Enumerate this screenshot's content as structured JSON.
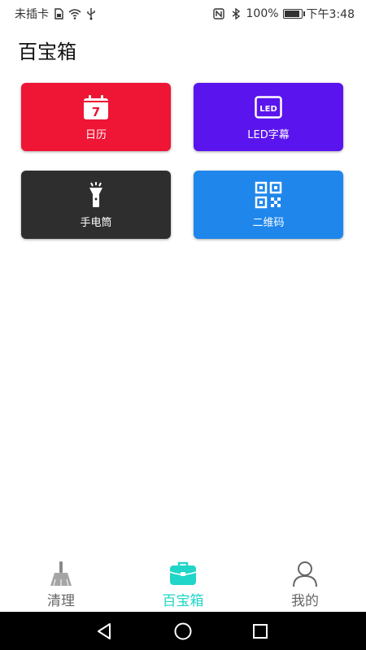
{
  "status_bar": {
    "carrier": "未插卡",
    "battery_percent": "100%",
    "battery_level": 1.0,
    "time": "下午3:48",
    "icons": [
      "sim-card-icon",
      "wifi-icon",
      "usb-icon",
      "nfc-icon",
      "bluetooth-icon",
      "battery-icon"
    ]
  },
  "page": {
    "title": "百宝箱"
  },
  "tools": [
    {
      "label": "日历",
      "icon": "calendar-icon",
      "icon_text": "7",
      "color": "#ee1535"
    },
    {
      "label": "LED字幕",
      "icon": "led-icon",
      "icon_text": "LED",
      "color": "#5a14ee"
    },
    {
      "label": "手电筒",
      "icon": "flashlight-icon",
      "color": "#2e2e2e"
    },
    {
      "label": "二维码",
      "icon": "qrcode-icon",
      "color": "#1f86eb"
    }
  ],
  "bottom_nav": {
    "items": [
      {
        "label": "清理",
        "icon": "broom-icon",
        "active": false
      },
      {
        "label": "百宝箱",
        "icon": "briefcase-icon",
        "active": true
      },
      {
        "label": "我的",
        "icon": "user-icon",
        "active": false
      }
    ],
    "active_color": "#1fd6c8",
    "inactive_color": "#666666"
  },
  "system_nav": {
    "buttons": [
      "back-icon",
      "home-icon",
      "recent-apps-icon"
    ]
  }
}
